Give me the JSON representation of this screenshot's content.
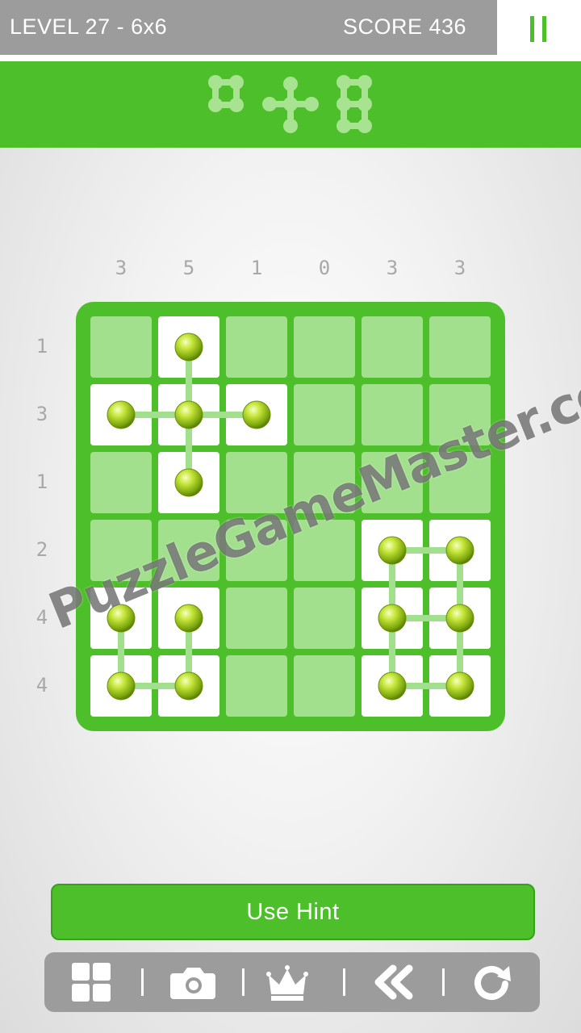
{
  "header": {
    "level": "LEVEL 27 - 6x6",
    "score": "SCORE 436"
  },
  "colors": {
    "green": "#4dbf2a",
    "light_green": "#a2e08e",
    "gray": "#9c9c9c",
    "clue": "#a8a8a8"
  },
  "shapes_preview": [
    "square-shape-icon",
    "cross-shape-icon",
    "tall-rectangle-shape-icon"
  ],
  "board": {
    "size": 6,
    "column_clues": [
      "3",
      "5",
      "1",
      "0",
      "3",
      "3"
    ],
    "row_clues": [
      "1",
      "3",
      "1",
      "2",
      "4",
      "4"
    ],
    "filled": [
      [
        0,
        1,
        0,
        0,
        0,
        0
      ],
      [
        1,
        1,
        1,
        0,
        0,
        0
      ],
      [
        0,
        1,
        0,
        0,
        0,
        0
      ],
      [
        0,
        0,
        0,
        0,
        1,
        1
      ],
      [
        1,
        1,
        0,
        0,
        1,
        1
      ],
      [
        1,
        1,
        0,
        0,
        1,
        1
      ]
    ],
    "links": [
      [
        [
          0,
          1
        ],
        [
          1,
          1
        ]
      ],
      [
        [
          1,
          0
        ],
        [
          1,
          1
        ]
      ],
      [
        [
          1,
          1
        ],
        [
          1,
          2
        ]
      ],
      [
        [
          1,
          1
        ],
        [
          2,
          1
        ]
      ],
      [
        [
          3,
          4
        ],
        [
          3,
          5
        ]
      ],
      [
        [
          3,
          4
        ],
        [
          4,
          4
        ]
      ],
      [
        [
          3,
          5
        ],
        [
          4,
          5
        ]
      ],
      [
        [
          4,
          4
        ],
        [
          4,
          5
        ]
      ],
      [
        [
          4,
          4
        ],
        [
          5,
          4
        ]
      ],
      [
        [
          4,
          5
        ],
        [
          5,
          5
        ]
      ],
      [
        [
          5,
          4
        ],
        [
          5,
          5
        ]
      ],
      [
        [
          4,
          0
        ],
        [
          5,
          0
        ]
      ],
      [
        [
          4,
          1
        ],
        [
          5,
          1
        ]
      ],
      [
        [
          5,
          0
        ],
        [
          5,
          1
        ]
      ]
    ]
  },
  "watermark": "PuzzleGameMaster.com",
  "hint_label": "Use Hint",
  "toolbar": [
    "grid-icon",
    "camera-icon",
    "crown-icon",
    "rewind-icon",
    "restart-icon"
  ]
}
